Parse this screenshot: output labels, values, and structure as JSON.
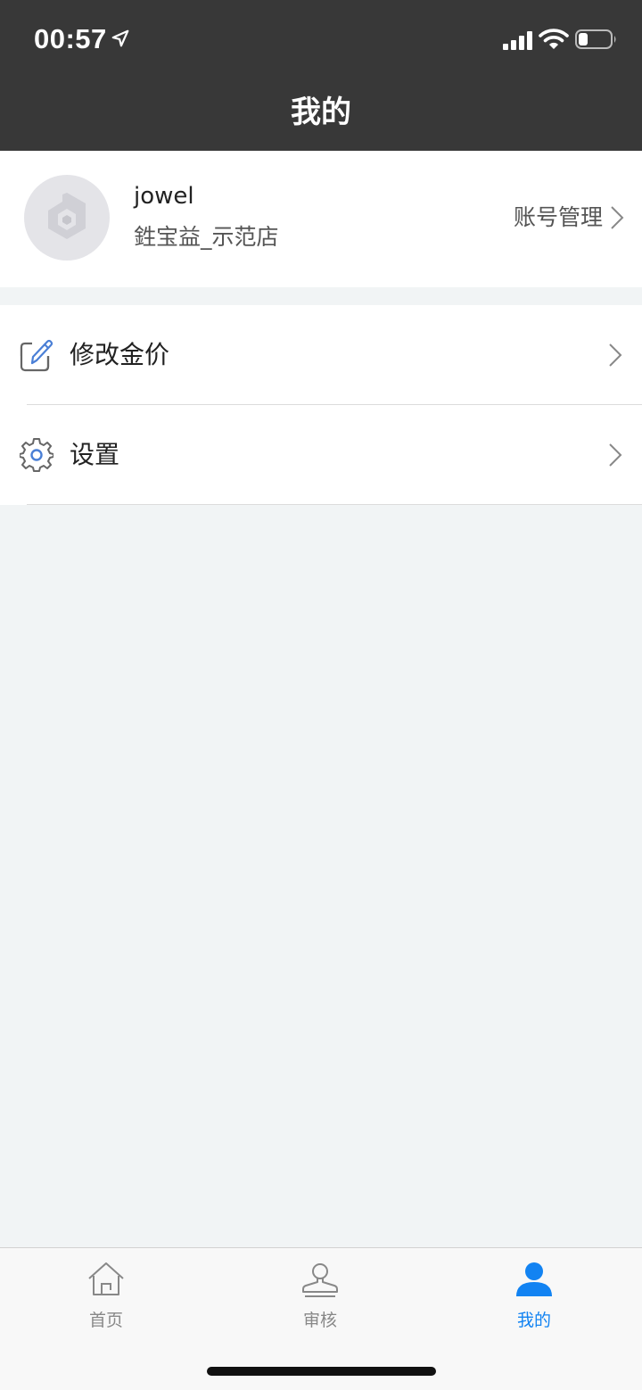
{
  "status_bar": {
    "time": "00:57",
    "icons": [
      "location-arrow-icon",
      "cellular-signal-icon",
      "wifi-icon",
      "battery-icon"
    ]
  },
  "header": {
    "title": "我的"
  },
  "profile": {
    "avatar_icon": "store-logo-icon",
    "username": "jowel",
    "store_name": "鉎宝益_示范店",
    "account_manage_label": "账号管理"
  },
  "menu": {
    "items": [
      {
        "label": "修改金价",
        "icon": "edit-icon"
      },
      {
        "label": "设置",
        "icon": "gear-icon"
      }
    ]
  },
  "tabbar": {
    "tabs": [
      {
        "label": "首页",
        "icon": "home-icon",
        "active": false
      },
      {
        "label": "审核",
        "icon": "stamp-icon",
        "active": false
      },
      {
        "label": "我的",
        "icon": "user-icon",
        "active": true
      }
    ]
  },
  "colors": {
    "header_bg": "#383838",
    "page_bg": "#f1f4f5",
    "accent": "#1283f2",
    "edit_icon": "#4a7fd6"
  }
}
